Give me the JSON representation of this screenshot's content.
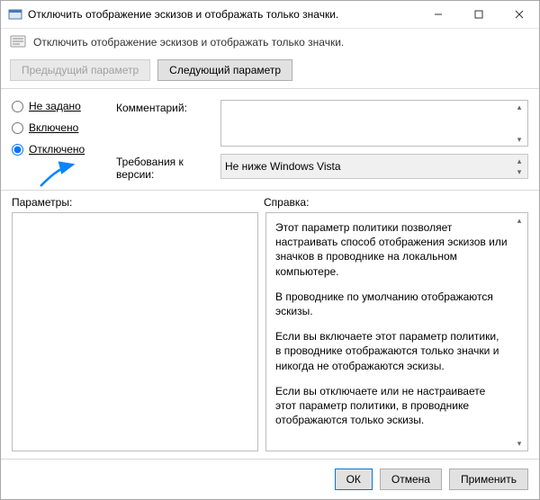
{
  "window": {
    "title": "Отключить отображение эскизов и отображать только значки."
  },
  "subheader": {
    "label": "Отключить отображение эскизов и отображать только значки."
  },
  "nav": {
    "prev": "Предыдущий параметр",
    "next": "Следующий параметр"
  },
  "state": {
    "not_configured": "Не задано",
    "enabled": "Включено",
    "disabled": "Отключено",
    "selected": "disabled"
  },
  "labels": {
    "comment": "Комментарий:",
    "requirements": "Требования к версии:",
    "parameters": "Параметры:",
    "help": "Справка:"
  },
  "fields": {
    "comment": "",
    "requirements": "Не ниже Windows Vista"
  },
  "help": {
    "p1": "Этот параметр политики позволяет настраивать способ отображения эскизов или значков в проводнике на локальном компьютере.",
    "p2": "В проводнике по умолчанию отображаются эскизы.",
    "p3": "Если вы включаете этот параметр политики, в проводнике отображаются только значки и никогда не отображаются эскизы.",
    "p4": "Если вы отключаете или не настраиваете этот параметр политики, в проводнике отображаются только эскизы."
  },
  "footer": {
    "ok": "ОК",
    "cancel": "Отмена",
    "apply": "Применить"
  }
}
